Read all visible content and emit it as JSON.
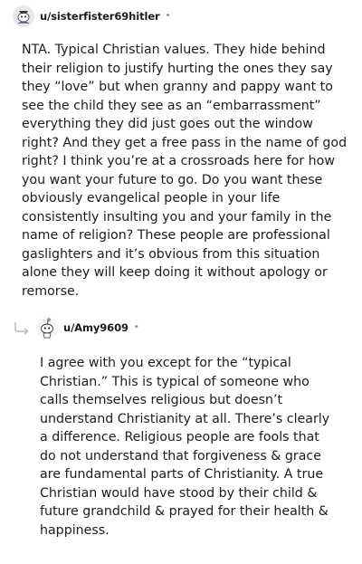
{
  "comments": [
    {
      "username": "u/sisterfister69hitler",
      "separator": "•",
      "avatar_icon": "snoo-avatar-icon",
      "text": "NTA. Typical Christian values. They hide behind their religion to justify hurting the ones they say they “love” but when granny and pappy want to see the child they see as an “embarrassment” everything they did just goes out the window right? And they get a free pass in the name of god right? I think you’re at a crossroads here for how you want your future to go. Do you want these obviously evangelical people in your life consistently insulting you and your family in the name of religion? These people are professional gaslighters and it’s obvious from this situation alone they will keep doing it without apology or remorse."
    },
    {
      "username": "u/Amy9609",
      "separator": "•",
      "avatar_icon": "snoo-avatar-icon",
      "reply_icon": "reply-arrow-icon",
      "text": "I agree with you except for the “typical Christian.” This is typical of someone who calls themselves religious but doesn’t understand Christianity at all. There’s clearly a difference. Religious people are fools that do not understand that forgiveness & grace are fundamental parts of Christianity. A true Christian would have stood by their child & future grandchild & prayed for their health & happiness."
    }
  ]
}
